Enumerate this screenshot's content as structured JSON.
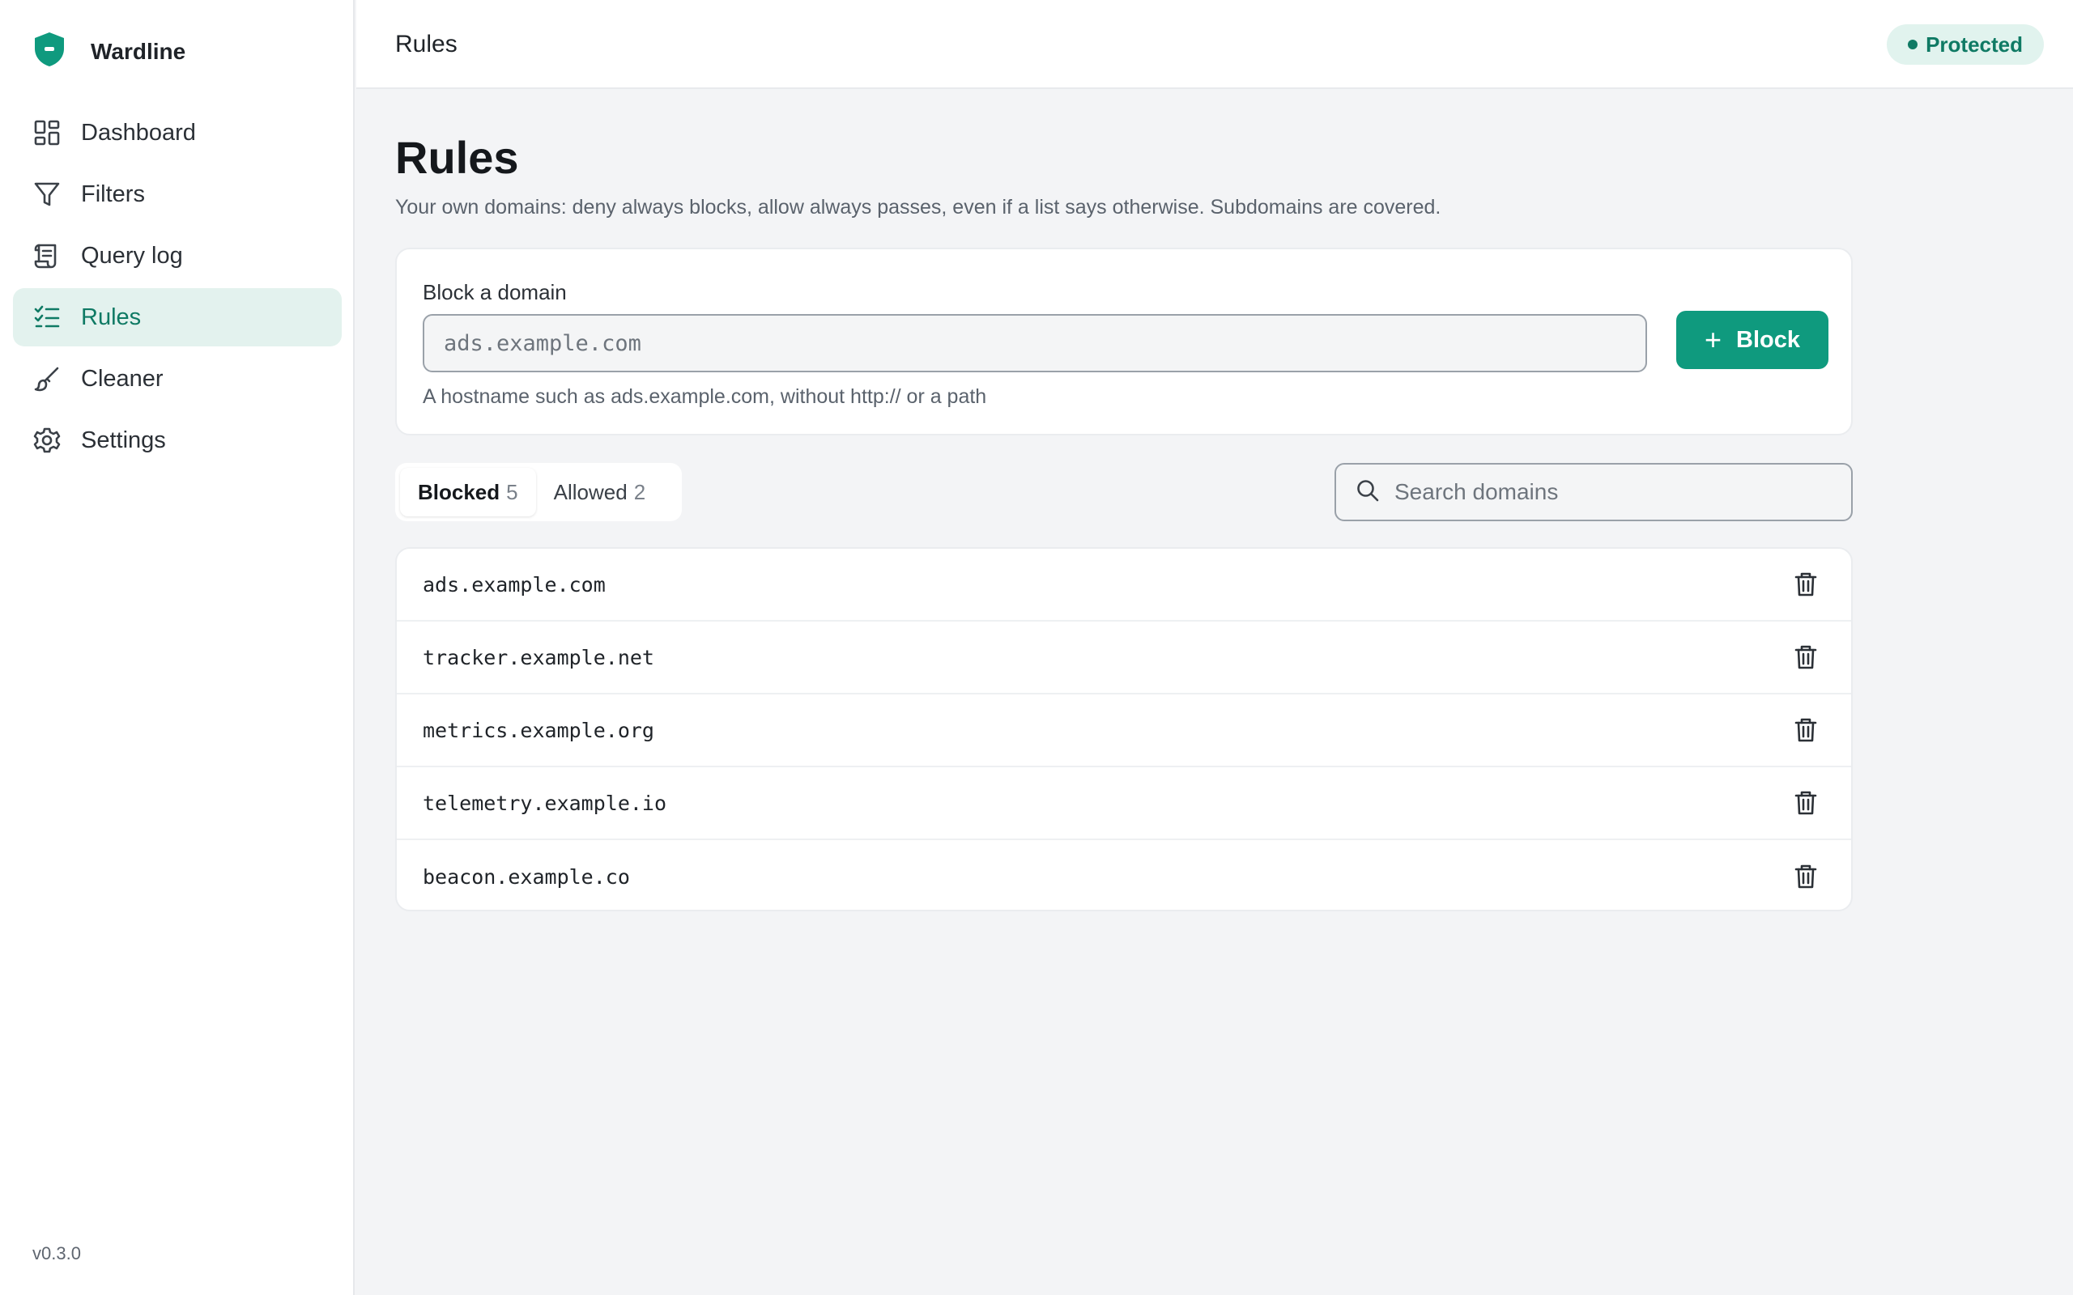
{
  "app": {
    "name": "Wardline",
    "version": "v0.3.0"
  },
  "sidebar": {
    "items": [
      {
        "label": "Dashboard",
        "icon": "dashboard-icon"
      },
      {
        "label": "Filters",
        "icon": "funnel-icon"
      },
      {
        "label": "Query log",
        "icon": "scroll-icon"
      },
      {
        "label": "Rules",
        "icon": "checklist-icon",
        "active": true
      },
      {
        "label": "Cleaner",
        "icon": "brush-icon"
      },
      {
        "label": "Settings",
        "icon": "gear-icon"
      }
    ]
  },
  "header": {
    "title": "Rules",
    "status": "Protected"
  },
  "page": {
    "title": "Rules",
    "description": "Your own domains: deny always blocks, allow always passes, even if a list says otherwise. Subdomains are covered."
  },
  "block_form": {
    "label": "Block a domain",
    "placeholder": "ads.example.com",
    "value": "",
    "button_label": "Block",
    "hint": "A hostname such as ads.example.com, without http:// or a path"
  },
  "tabs": [
    {
      "label": "Blocked",
      "count": "5",
      "active": true
    },
    {
      "label": "Allowed",
      "count": "2",
      "active": false
    }
  ],
  "search": {
    "placeholder": "Search domains"
  },
  "rules": [
    {
      "domain": "ads.example.com"
    },
    {
      "domain": "tracker.example.net"
    },
    {
      "domain": "metrics.example.org"
    },
    {
      "domain": "telemetry.example.io"
    },
    {
      "domain": "beacon.example.co"
    }
  ],
  "colors": {
    "accent": "#0f9a7e",
    "accent_text": "#0f7a64",
    "accent_soft": "#e3f2ee"
  }
}
